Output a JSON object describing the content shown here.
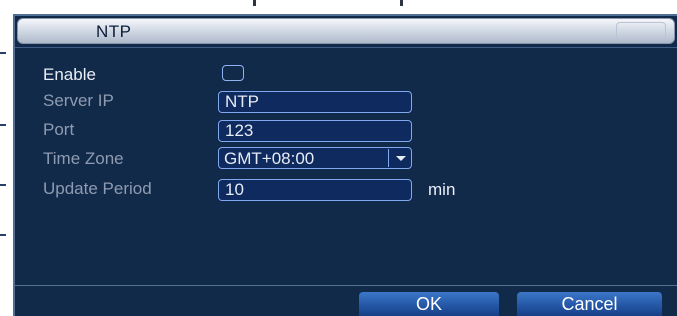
{
  "dialog": {
    "title": "NTP"
  },
  "form": {
    "enable": {
      "label": "Enable",
      "checked": false
    },
    "server_ip": {
      "label": "Server IP",
      "value": "NTP"
    },
    "port": {
      "label": "Port",
      "value": "123"
    },
    "time_zone": {
      "label": "Time Zone",
      "selected": "GMT+08:00"
    },
    "update_period": {
      "label": "Update Period",
      "value": "10",
      "unit": "min"
    }
  },
  "buttons": {
    "ok": "OK",
    "cancel": "Cancel"
  },
  "colors": {
    "panel": "#122a4a",
    "field": "#0f2a5e",
    "field_border": "#7fa8ee",
    "button": "#2355a3",
    "label_dim": "#8e9bb0"
  },
  "icons": {
    "dropdown": "chevron-down-icon"
  }
}
